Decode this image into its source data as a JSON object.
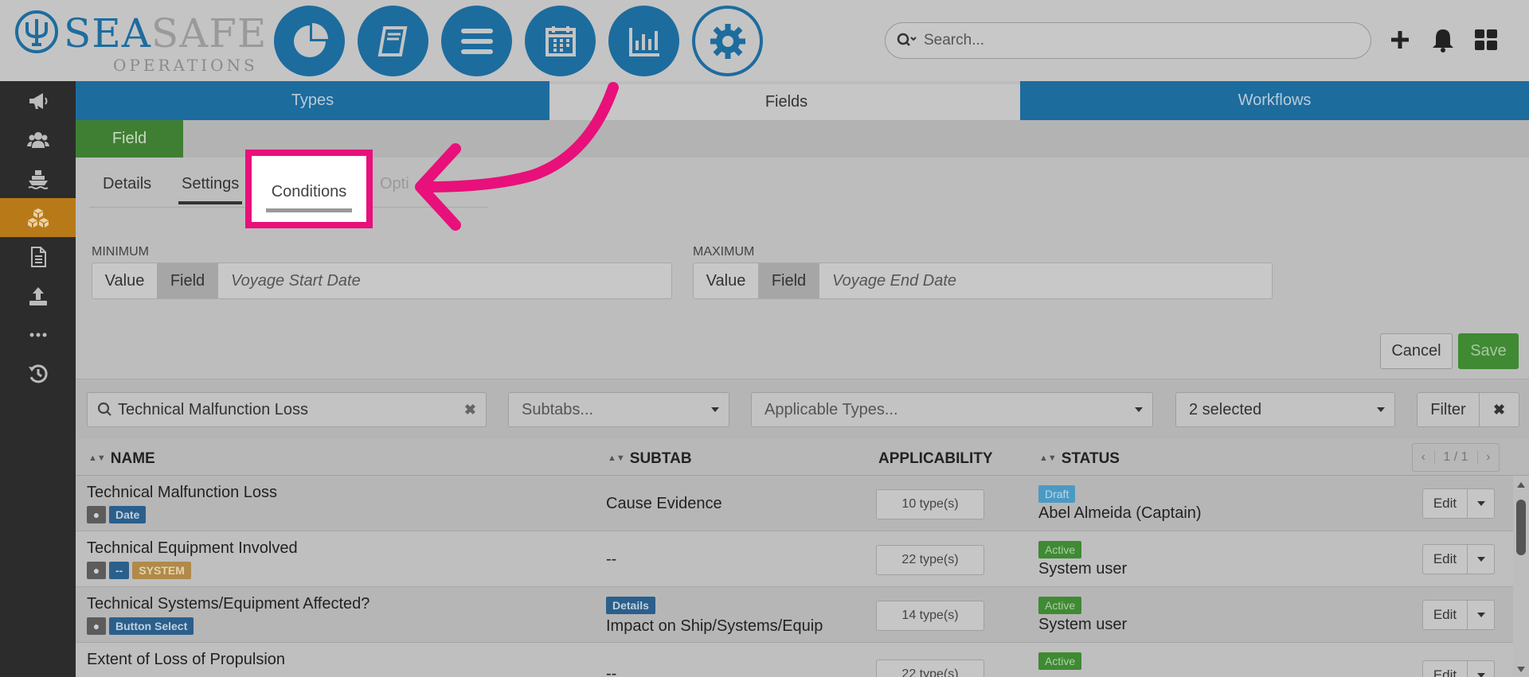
{
  "brand": {
    "word_sea": "SEA",
    "word_safe": "SAFE",
    "subtitle": "OPERATIONS"
  },
  "header": {
    "search_placeholder": "Search..."
  },
  "main_tabs": [
    {
      "label": "Types"
    },
    {
      "label": "Fields"
    },
    {
      "label": "Workflows"
    }
  ],
  "field_tab": "Field",
  "sub_tabs": [
    {
      "label": "Details"
    },
    {
      "label": "Settings"
    },
    {
      "label": "Conditions"
    },
    {
      "label": "Opti"
    }
  ],
  "range": {
    "min": {
      "label": "MINIMUM",
      "value_btn": "Value",
      "field_btn": "Field",
      "value": "Voyage Start Date"
    },
    "max": {
      "label": "MAXIMUM",
      "value_btn": "Value",
      "field_btn": "Field",
      "value": "Voyage End Date"
    }
  },
  "actions": {
    "cancel": "Cancel",
    "save": "Save"
  },
  "filters": {
    "search_value": "Technical Malfunction Loss",
    "subtabs_placeholder": "Subtabs...",
    "types_placeholder": "Applicable Types...",
    "status_selected": "2 selected",
    "filter_button": "Filter"
  },
  "table": {
    "headers": {
      "name": "NAME",
      "subtab": "SUBTAB",
      "applicability": "APPLICABILITY",
      "status": "STATUS"
    },
    "pager": "1 / 1",
    "edit_label": "Edit",
    "rows": [
      {
        "name": "Technical Malfunction Loss",
        "type_tag": "Date",
        "sys_tag": "",
        "subtab_tag": "",
        "subtab": "Cause Evidence",
        "applicability": "10 type(s)",
        "status": "Draft",
        "user": "Abel Almeida (Captain)"
      },
      {
        "name": "Technical Equipment Involved",
        "type_tag": "--",
        "sys_tag": "SYSTEM",
        "subtab_tag": "",
        "subtab": "--",
        "applicability": "22 type(s)",
        "status": "Active",
        "user": "System user"
      },
      {
        "name": "Technical Systems/Equipment Affected?",
        "type_tag": "Button Select",
        "sys_tag": "",
        "subtab_tag": "Details",
        "subtab": "Impact on Ship/Systems/Equip",
        "applicability": "14 type(s)",
        "status": "Active",
        "user": "System user"
      },
      {
        "name": "Extent of Loss of Propulsion",
        "type_tag": "",
        "sys_tag": "",
        "subtab_tag": "",
        "subtab": "--",
        "applicability": "22 type(s)",
        "status": "Active",
        "user": ""
      }
    ]
  },
  "colors": {
    "accent": "#1d6c9e",
    "highlight": "#e8107a",
    "active_green": "#3f8a33",
    "sidebar_active": "#b87a18"
  },
  "icons": {
    "nav": [
      "pie-chart-icon",
      "book-icon",
      "list-icon",
      "calendar-icon",
      "bar-chart-icon",
      "gear-icon"
    ],
    "sidebar": [
      "megaphone-icon",
      "users-icon",
      "ship-icon",
      "cubes-icon",
      "document-icon",
      "upload-icon",
      "more-icon",
      "history-icon"
    ]
  }
}
